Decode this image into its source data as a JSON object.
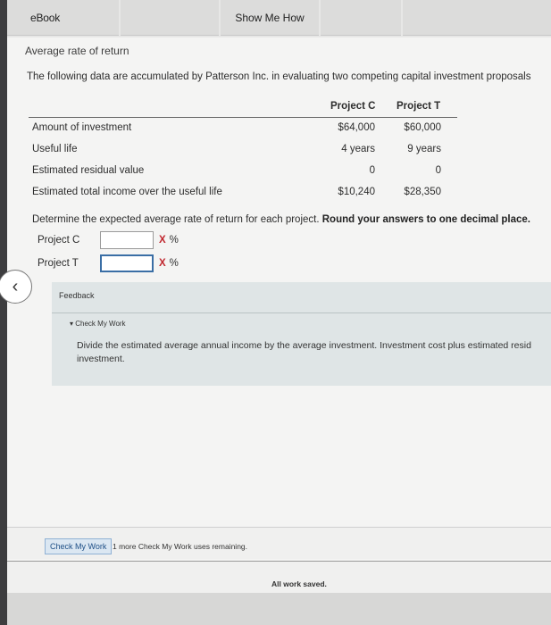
{
  "tabs": {
    "ebook": "eBook",
    "show_me_how": "Show Me How"
  },
  "page": {
    "title": "Average rate of return",
    "intro": "The following data are accumulated by Patterson Inc. in evaluating two competing capital investment proposals"
  },
  "table": {
    "headers": [
      "Project C",
      "Project T"
    ],
    "rows": [
      {
        "label": "Amount of investment",
        "c": "$64,000",
        "t": "$60,000"
      },
      {
        "label": "Useful life",
        "c": "4 years",
        "t": "9 years"
      },
      {
        "label": "Estimated residual value",
        "c": "0",
        "t": "0"
      },
      {
        "label": "Estimated total income over the useful life",
        "c": "$10,240",
        "t": "$28,350"
      }
    ]
  },
  "question": {
    "text": "Determine the expected average rate of return for each project. ",
    "bold": "Round your answers to one decimal place."
  },
  "answers": [
    {
      "label": "Project C",
      "value": "",
      "mark": "X",
      "unit": "%"
    },
    {
      "label": "Project T",
      "value": "",
      "mark": "X",
      "unit": "%"
    }
  ],
  "feedback": {
    "title": "Feedback",
    "section": "Check My Work",
    "hint": "Divide the estimated average annual income by the average investment. Investment cost plus estimated resid investment."
  },
  "footer": {
    "check_button": "Check My Work",
    "remaining": "1 more Check My Work uses remaining.",
    "saved": "All work saved."
  },
  "colors": {
    "incorrect_mark": "#c0262d",
    "focus_border": "#3a6ea5"
  }
}
